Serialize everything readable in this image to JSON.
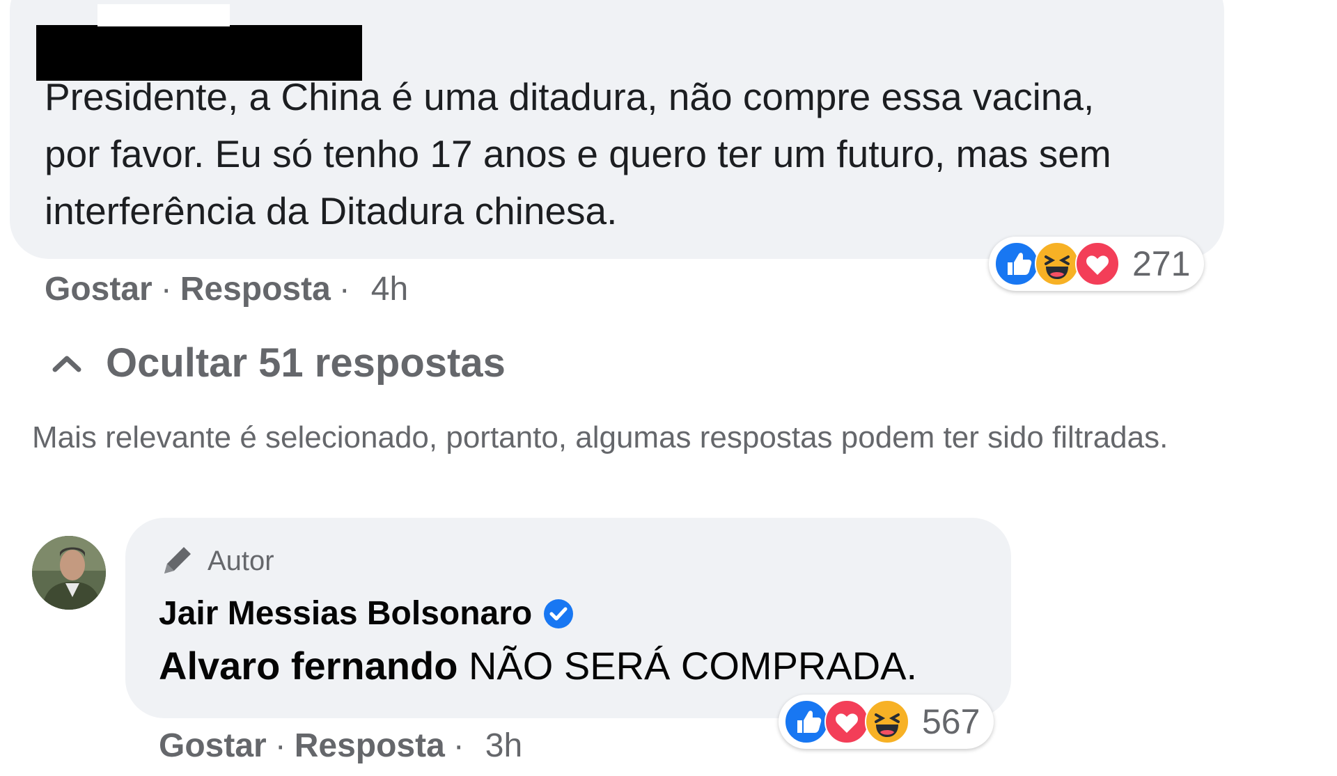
{
  "top_comment": {
    "text": "Presidente, a China é uma ditadura, não compre essa vacina, por favor. Eu só tenho 17 anos e quero ter um futuro, mas sem interferência da Ditadura chinesa.",
    "reactions": {
      "icons": [
        "like-icon",
        "haha-icon",
        "love-icon"
      ],
      "count": "271"
    },
    "actions": {
      "like": "Gostar",
      "reply": "Resposta",
      "separator": "·",
      "time": "4h"
    }
  },
  "replies_toggle": {
    "label": "Ocultar 51 respostas",
    "icon": "chevron-up-icon"
  },
  "filter_note": "Mais relevante é selecionado, portanto, algumas respostas podem ter sido filtradas.",
  "reply": {
    "badge": "Autor",
    "author": "Jair Messias Bolsonaro",
    "verified": true,
    "mention": "Alvaro fernando",
    "text": "NÃO SERÁ COMPRADA.",
    "reactions": {
      "icons": [
        "like-icon",
        "love-icon",
        "haha-icon"
      ],
      "count": "567"
    },
    "actions": {
      "like": "Gostar",
      "reply": "Resposta",
      "separator": "·",
      "time": "3h"
    }
  },
  "colors": {
    "bubble": "#f0f2f5",
    "secondary_text": "#65676b",
    "like_blue": "#1877f2",
    "love_red": "#f33e58",
    "haha_yellow": "#f7b125"
  }
}
